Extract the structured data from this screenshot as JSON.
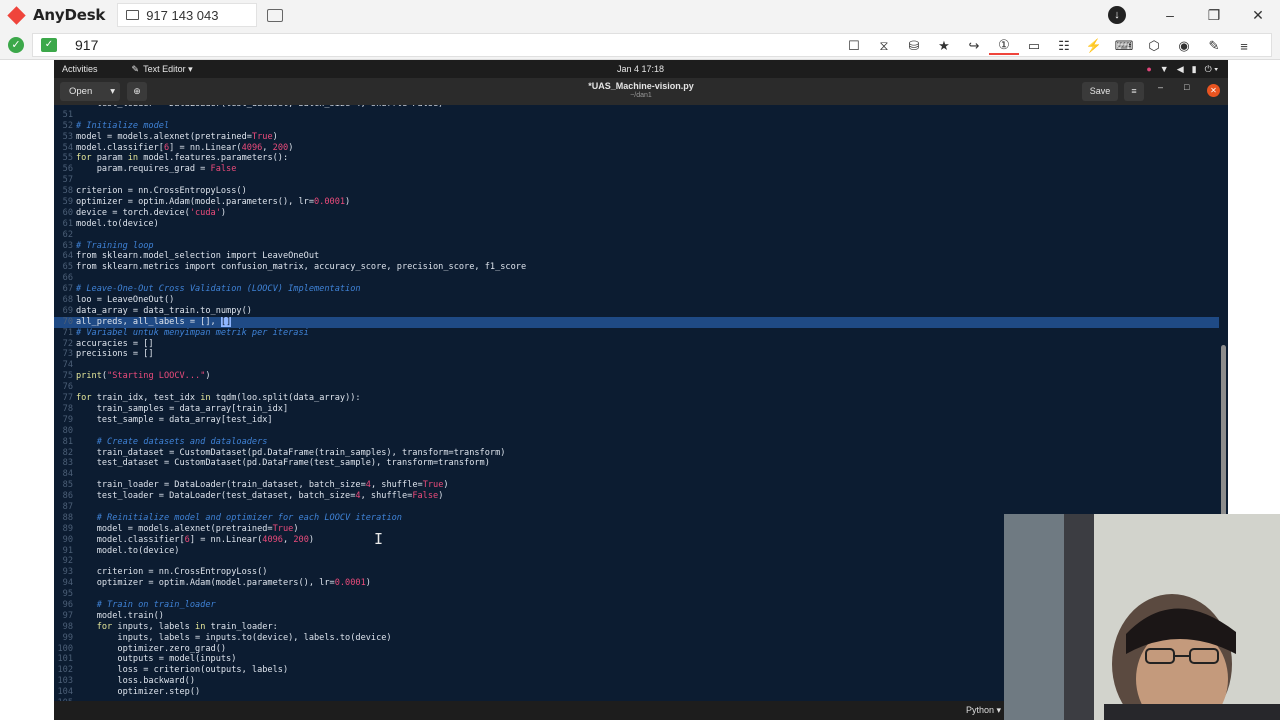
{
  "anydesk": {
    "app_name": "AnyDesk",
    "session_tab": "917 143 043",
    "address": "917",
    "toolbar_icons": [
      "privacy-icon",
      "hourglass-icon",
      "database-icon",
      "star-icon",
      "forward-icon",
      "monitor-1-icon",
      "display-icon",
      "chat-icon",
      "lightning-icon",
      "keyboard-icon",
      "shield-icon",
      "record-icon",
      "pen-icon",
      "menu-icon"
    ]
  },
  "gnome": {
    "activities": "Activities",
    "app_menu": "Text Editor ▾",
    "clock": "Jan 4  17:18"
  },
  "gedit": {
    "open_label": "Open",
    "title": "*UAS_Machine-vision.py",
    "subtitle": "~/dan1",
    "save_label": "Save",
    "language": "Python ▾"
  },
  "code_lines": [
    {
      "n": "",
      "segs": [
        [
          "",
          "    test_loader = DataLoader(test_dataset, batch_size=4, shuffle=False)"
        ]
      ]
    },
    {
      "n": "51",
      "segs": []
    },
    {
      "n": "52",
      "segs": [
        [
          "cm",
          "# Initialize model"
        ]
      ]
    },
    {
      "n": "53",
      "segs": [
        [
          "",
          "model = models.alexnet(pretrained="
        ],
        [
          "st",
          "True"
        ],
        [
          "",
          ")"
        ]
      ]
    },
    {
      "n": "54",
      "segs": [
        [
          "",
          "model.classifier["
        ],
        [
          "st",
          "6"
        ],
        [
          "",
          "] = nn.Linear("
        ],
        [
          "st",
          "4096"
        ],
        [
          "",
          ", "
        ],
        [
          "st",
          "200"
        ],
        [
          "",
          ")"
        ]
      ]
    },
    {
      "n": "55",
      "segs": [
        [
          "kw",
          "for"
        ],
        [
          "",
          " param "
        ],
        [
          "kw",
          "in"
        ],
        [
          "",
          " model.features.parameters():"
        ]
      ]
    },
    {
      "n": "56",
      "segs": [
        [
          "",
          "    param.requires_grad = "
        ],
        [
          "st",
          "False"
        ]
      ]
    },
    {
      "n": "57",
      "segs": []
    },
    {
      "n": "58",
      "segs": [
        [
          "",
          "criterion = nn.CrossEntropyLoss()"
        ]
      ]
    },
    {
      "n": "59",
      "segs": [
        [
          "",
          "optimizer = optim.Adam(model.parameters(), lr="
        ],
        [
          "st",
          "0.0001"
        ],
        [
          "",
          ")"
        ]
      ]
    },
    {
      "n": "60",
      "segs": [
        [
          "",
          "device = torch.device("
        ],
        [
          "st",
          "'cuda'"
        ],
        [
          "",
          ")"
        ]
      ]
    },
    {
      "n": "61",
      "segs": [
        [
          "",
          "model.to(device)"
        ]
      ]
    },
    {
      "n": "62",
      "segs": []
    },
    {
      "n": "63",
      "segs": [
        [
          "cm",
          "# Training loop"
        ]
      ]
    },
    {
      "n": "64",
      "segs": [
        [
          "",
          "from sklearn.model_selection import LeaveOneOut"
        ]
      ]
    },
    {
      "n": "65",
      "segs": [
        [
          "",
          "from sklearn.metrics import confusion_matrix, accuracy_score, precision_score, f1_score"
        ]
      ]
    },
    {
      "n": "66",
      "segs": []
    },
    {
      "n": "67",
      "segs": [
        [
          "cm",
          "# Leave-One-Out Cross Validation (LOOCV) Implementation"
        ]
      ]
    },
    {
      "n": "68",
      "segs": [
        [
          "",
          "loo = LeaveOneOut()"
        ]
      ]
    },
    {
      "n": "69",
      "segs": [
        [
          "",
          "data_array = data_train.to_numpy()"
        ]
      ]
    },
    {
      "n": "70",
      "cur": true,
      "segs": [
        [
          "",
          "all_preds, all_labels = [], "
        ],
        [
          "sel",
          "[]"
        ]
      ]
    },
    {
      "n": "71",
      "segs": [
        [
          "cm",
          "# Variabel untuk menyimpan metrik per iterasi"
        ]
      ]
    },
    {
      "n": "72",
      "segs": [
        [
          "",
          "accuracies = []"
        ]
      ]
    },
    {
      "n": "73",
      "segs": [
        [
          "",
          "precisions = []"
        ]
      ]
    },
    {
      "n": "74",
      "segs": []
    },
    {
      "n": "75",
      "segs": [
        [
          "kw",
          "print"
        ],
        [
          "",
          "("
        ],
        [
          "st",
          "\"Starting LOOCV...\""
        ],
        [
          "",
          ")"
        ]
      ]
    },
    {
      "n": "76",
      "segs": []
    },
    {
      "n": "77",
      "segs": [
        [
          "kw",
          "for"
        ],
        [
          "",
          " train_idx, test_idx "
        ],
        [
          "kw",
          "in"
        ],
        [
          "",
          " tqdm(loo.split(data_array)):"
        ]
      ]
    },
    {
      "n": "78",
      "segs": [
        [
          "",
          "    train_samples = data_array[train_idx]"
        ]
      ]
    },
    {
      "n": "79",
      "segs": [
        [
          "",
          "    test_sample = data_array[test_idx]"
        ]
      ]
    },
    {
      "n": "80",
      "segs": []
    },
    {
      "n": "81",
      "segs": [
        [
          "",
          "    "
        ],
        [
          "cm",
          "# Create datasets and dataloaders"
        ]
      ]
    },
    {
      "n": "82",
      "segs": [
        [
          "",
          "    train_dataset = CustomDataset(pd.DataFrame(train_samples), transform=transform)"
        ]
      ]
    },
    {
      "n": "83",
      "segs": [
        [
          "",
          "    test_dataset = CustomDataset(pd.DataFrame(test_sample), transform=transform)"
        ]
      ]
    },
    {
      "n": "84",
      "segs": []
    },
    {
      "n": "85",
      "segs": [
        [
          "",
          "    train_loader = DataLoader(train_dataset, batch_size="
        ],
        [
          "st",
          "4"
        ],
        [
          "",
          ", shuffle="
        ],
        [
          "st",
          "True"
        ],
        [
          "",
          ")"
        ]
      ]
    },
    {
      "n": "86",
      "segs": [
        [
          "",
          "    test_loader = DataLoader(test_dataset, batch_size="
        ],
        [
          "st",
          "4"
        ],
        [
          "",
          ", shuffle="
        ],
        [
          "st",
          "False"
        ],
        [
          "",
          ")"
        ]
      ]
    },
    {
      "n": "87",
      "segs": []
    },
    {
      "n": "88",
      "segs": [
        [
          "",
          "    "
        ],
        [
          "cm",
          "# Reinitialize model and optimizer for each LOOCV iteration"
        ]
      ]
    },
    {
      "n": "89",
      "segs": [
        [
          "",
          "    model = models.alexnet(pretrained="
        ],
        [
          "st",
          "True"
        ],
        [
          "",
          ")"
        ]
      ]
    },
    {
      "n": "90",
      "segs": [
        [
          "",
          "    model.classifier["
        ],
        [
          "st",
          "6"
        ],
        [
          "",
          "] = nn.Linear("
        ],
        [
          "st",
          "4096"
        ],
        [
          "",
          ", "
        ],
        [
          "st",
          "200"
        ],
        [
          "",
          ")"
        ]
      ]
    },
    {
      "n": "91",
      "segs": [
        [
          "",
          "    model.to(device)"
        ]
      ]
    },
    {
      "n": "92",
      "segs": []
    },
    {
      "n": "93",
      "segs": [
        [
          "",
          "    criterion = nn.CrossEntropyLoss()"
        ]
      ]
    },
    {
      "n": "94",
      "segs": [
        [
          "",
          "    optimizer = optim.Adam(model.parameters(), lr="
        ],
        [
          "st",
          "0.0001"
        ],
        [
          "",
          ")"
        ]
      ]
    },
    {
      "n": "95",
      "segs": []
    },
    {
      "n": "96",
      "segs": [
        [
          "",
          "    "
        ],
        [
          "cm",
          "# Train on train_loader"
        ]
      ]
    },
    {
      "n": "97",
      "segs": [
        [
          "",
          "    model.train()"
        ]
      ]
    },
    {
      "n": "98",
      "segs": [
        [
          "",
          "    "
        ],
        [
          "kw",
          "for"
        ],
        [
          "",
          " inputs, labels "
        ],
        [
          "kw",
          "in"
        ],
        [
          "",
          " train_loader:"
        ]
      ]
    },
    {
      "n": "99",
      "segs": [
        [
          "",
          "        inputs, labels = inputs.to(device), labels.to(device)"
        ]
      ]
    },
    {
      "n": "100",
      "segs": [
        [
          "",
          "        optimizer.zero_grad()"
        ]
      ]
    },
    {
      "n": "101",
      "segs": [
        [
          "",
          "        outputs = model(inputs)"
        ]
      ]
    },
    {
      "n": "102",
      "segs": [
        [
          "",
          "        loss = criterion(outputs, labels)"
        ]
      ]
    },
    {
      "n": "103",
      "segs": [
        [
          "",
          "        loss.backward()"
        ]
      ]
    },
    {
      "n": "104",
      "segs": [
        [
          "",
          "        optimizer.step()"
        ]
      ]
    },
    {
      "n": "105",
      "segs": []
    }
  ],
  "colors": {
    "anydesk_red": "#ef443b",
    "editor_bg": "#0c1c31",
    "keyword": "#e4e69a",
    "comment": "#3f82d6",
    "string": "#ea4b7b",
    "ubuntu_close": "#e95420"
  }
}
